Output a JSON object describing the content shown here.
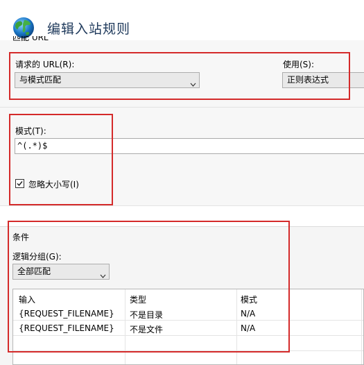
{
  "window": {
    "title": "编辑入站规则"
  },
  "match_url": {
    "section_label": "匹配 URL",
    "requested_url_label": "请求的 URL(R):",
    "requested_url_value": "与模式匹配",
    "using_label": "使用(S):",
    "using_value": "正则表达式",
    "pattern_label": "模式(T):",
    "pattern_value": "^(.*)$",
    "ignore_case_label": "忽略大小写(I)",
    "ignore_case_checked": true
  },
  "conditions": {
    "section_label": "条件",
    "logical_grouping_label": "逻辑分组(G):",
    "logical_grouping_value": "全部匹配",
    "columns": [
      "输入",
      "类型",
      "模式"
    ],
    "rows": [
      [
        "{REQUEST_FILENAME}",
        "不是目录",
        "N/A"
      ],
      [
        "{REQUEST_FILENAME}",
        "不是文件",
        "N/A"
      ]
    ]
  },
  "colors": {
    "highlight_border": "#d42a2a",
    "title_text": "#1e395b",
    "section_background": "#f7f7f7"
  },
  "icons": [
    "globe-icon",
    "chevron-down-icon",
    "checkmark-icon"
  ]
}
